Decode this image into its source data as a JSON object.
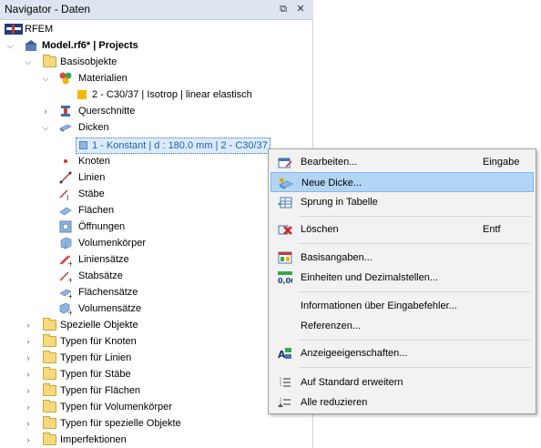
{
  "navigator": {
    "title": "Navigator - Daten",
    "pin_glyph": "⧉",
    "close_glyph": "✕",
    "root": "RFEM",
    "model": "Model.rf6* | Projects",
    "basisobjekte": "Basisobjekte",
    "materialien": "Materialien",
    "material_item": "2 - C30/37 | Isotrop | linear elastisch",
    "querschnitte": "Querschnitte",
    "dicken": "Dicken",
    "dicke_item": "1 - Konstant | d : 180.0 mm | 2 - C30/37",
    "items": [
      "Knoten",
      "Linien",
      "Stäbe",
      "Flächen",
      "Öffnungen",
      "Volumenkörper",
      "Liniensätze",
      "Stabsätze",
      "Flächensätze",
      "Volumensätze"
    ],
    "folders": [
      "Spezielle Objekte",
      "Typen für Knoten",
      "Typen für Linien",
      "Typen für Stäbe",
      "Typen für Flächen",
      "Typen für Volumenkörper",
      "Typen für spezielle Objekte",
      "Imperfektionen"
    ]
  },
  "context_menu": {
    "bearbeiten": "Bearbeiten...",
    "bearbeiten_shortcut": "Eingabe",
    "neue_dicke": "Neue Dicke...",
    "sprung": "Sprung in Tabelle",
    "loeschen": "Löschen",
    "loeschen_shortcut": "Entf",
    "basisangaben": "Basisangaben...",
    "einheiten": "Einheiten und Dezimalstellen...",
    "einheiten_icon_text": "0,00",
    "informationen": "Informationen über Eingabefehler...",
    "referenzen": "Referenzen...",
    "anzeige": "Anzeigeeigenschaften...",
    "auf_standard": "Auf Standard erweitern",
    "alle_reduzieren": "Alle reduzieren"
  },
  "colors": {
    "selection_bg": "#dcebfc",
    "menu_highlight": "#b2d5f5",
    "folder": "#f6d97a"
  }
}
